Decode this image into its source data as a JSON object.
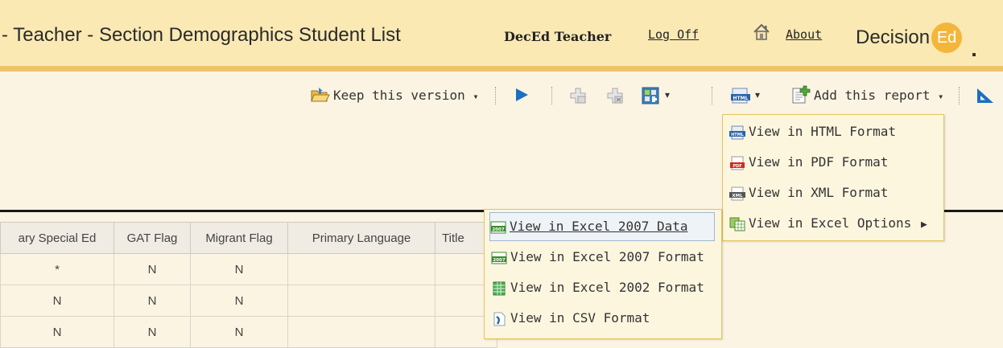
{
  "header": {
    "title": "- Teacher - Section Demographics Student List",
    "user": "DecEd Teacher",
    "logoff": "Log Off",
    "about": "About",
    "logo_text": "Decision",
    "logo_badge": "Ed"
  },
  "toolbar": {
    "keep_version": "Keep this version",
    "add_report": "Add this report",
    "caret": "▾"
  },
  "table": {
    "headers": [
      "ary Special Ed",
      "GAT Flag",
      "Migrant Flag",
      "Primary Language",
      "Title"
    ],
    "rows": [
      [
        "*",
        "N",
        "N",
        "",
        ""
      ],
      [
        "N",
        "N",
        "N",
        "",
        ""
      ],
      [
        "N",
        "N",
        "N",
        "",
        ""
      ]
    ]
  },
  "format_menu": {
    "items": [
      "View in HTML Format",
      "View in PDF Format",
      "View in XML Format",
      "View in Excel Options"
    ],
    "submenu_arrow": "▶"
  },
  "excel_menu": {
    "items": [
      "View in Excel 2007 Data",
      "View in Excel 2007 Format",
      "View in Excel 2002 Format",
      "View in CSV Format"
    ]
  },
  "colors": {
    "header_bg": "#fbe9b4",
    "header_bar": "#eec46a",
    "page_bg": "#fbf4e2",
    "accent_blue": "#1b6fc4",
    "logo_orange": "#f4b63a"
  }
}
